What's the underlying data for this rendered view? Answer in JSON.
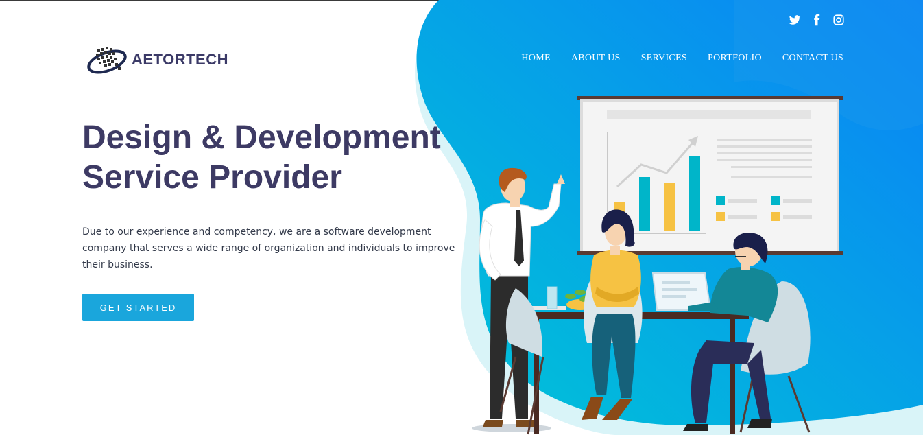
{
  "brand": {
    "name": "AETORTECH"
  },
  "social": [
    {
      "icon": "twitter-icon"
    },
    {
      "icon": "facebook-icon"
    },
    {
      "icon": "instagram-icon"
    }
  ],
  "nav": {
    "items": [
      {
        "label": "HOME"
      },
      {
        "label": "ABOUT US"
      },
      {
        "label": "SERVICES"
      },
      {
        "label": "PORTFOLIO"
      },
      {
        "label": "CONTACT US"
      }
    ]
  },
  "hero": {
    "title_line1": "Design & Development",
    "title_line2": "Service Provider",
    "description": "Due to our experience and competency, we are a software development company that serves a wide range of organization and individuals to improve their business.",
    "cta_label": "GET STARTED"
  },
  "colors": {
    "accent": "#1aa6dc",
    "heading": "#3d3a64",
    "gradient_start": "#00c2d8",
    "gradient_end": "#0a84f5"
  }
}
